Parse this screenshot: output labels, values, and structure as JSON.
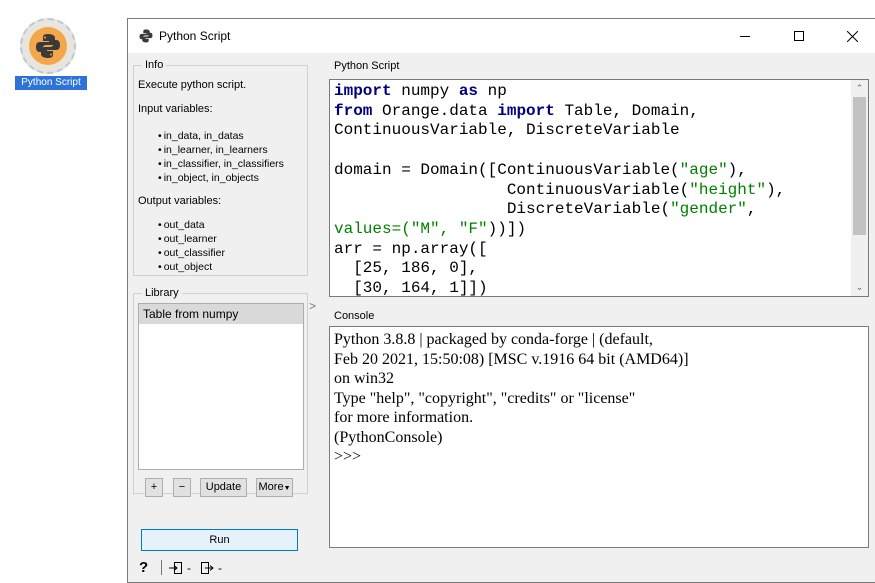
{
  "desktop": {
    "widget_label": "Python Script"
  },
  "window": {
    "title": "Python Script",
    "controls": {
      "minimize": "—",
      "maximize": "☐",
      "close": "✕"
    }
  },
  "info": {
    "legend": "Info",
    "description": "Execute python script.",
    "input_heading": "Input variables:",
    "inputs": [
      "in_data, in_datas",
      "in_learner, in_learners",
      "in_classifier, in_classifiers",
      "in_object, in_objects"
    ],
    "output_heading": "Output variables:",
    "outputs": [
      "out_data",
      "out_learner",
      "out_classifier",
      "out_object"
    ]
  },
  "library": {
    "legend": "Library",
    "items": [
      "Table from numpy"
    ],
    "buttons": {
      "add": "+",
      "remove": "−",
      "update": "Update",
      "more": "More"
    }
  },
  "run_label": "Run",
  "footer": {
    "help": "?",
    "input": "-",
    "output": "-"
  },
  "splitter": ">",
  "editor": {
    "label": "Python Script",
    "lines": [
      [
        {
          "t": "import",
          "c": "kw"
        },
        {
          "t": " numpy "
        },
        {
          "t": "as",
          "c": "kw"
        },
        {
          "t": " np"
        }
      ],
      [
        {
          "t": "from",
          "c": "kw"
        },
        {
          "t": " Orange.data "
        },
        {
          "t": "import",
          "c": "kw"
        },
        {
          "t": " Table, Domain,"
        }
      ],
      [
        {
          "t": "ContinuousVariable, DiscreteVariable"
        }
      ],
      [
        {
          "t": ""
        }
      ],
      [
        {
          "t": "domain = Domain([ContinuousVariable("
        },
        {
          "t": "\"age\"",
          "c": "str"
        },
        {
          "t": "),"
        }
      ],
      [
        {
          "t": "                  ContinuousVariable("
        },
        {
          "t": "\"height\"",
          "c": "str"
        },
        {
          "t": "),"
        }
      ],
      [
        {
          "t": "                  DiscreteVariable("
        },
        {
          "t": "\"gender\"",
          "c": "str"
        },
        {
          "t": ","
        }
      ],
      [
        {
          "t": "values=(",
          "c": "str"
        },
        {
          "t": "\"M\"",
          "c": "str"
        },
        {
          "t": ", ",
          "c": "str"
        },
        {
          "t": "\"F\"",
          "c": "str"
        },
        {
          "t": "))])"
        }
      ],
      [
        {
          "t": "arr = np.array(["
        }
      ],
      [
        {
          "t": "  [25, 186, 0],"
        }
      ],
      [
        {
          "t": "  [30, 164, 1]])"
        }
      ]
    ]
  },
  "console": {
    "label": "Console",
    "lines": [
      "Python 3.8.8 | packaged by conda-forge | (default,",
      "Feb 20 2021, 15:50:08) [MSC v.1916 64 bit (AMD64)]",
      "on win32",
      "Type \"help\", \"copyright\", \"credits\" or \"license\"",
      "for more information.",
      "(PythonConsole)",
      ">>> "
    ]
  }
}
